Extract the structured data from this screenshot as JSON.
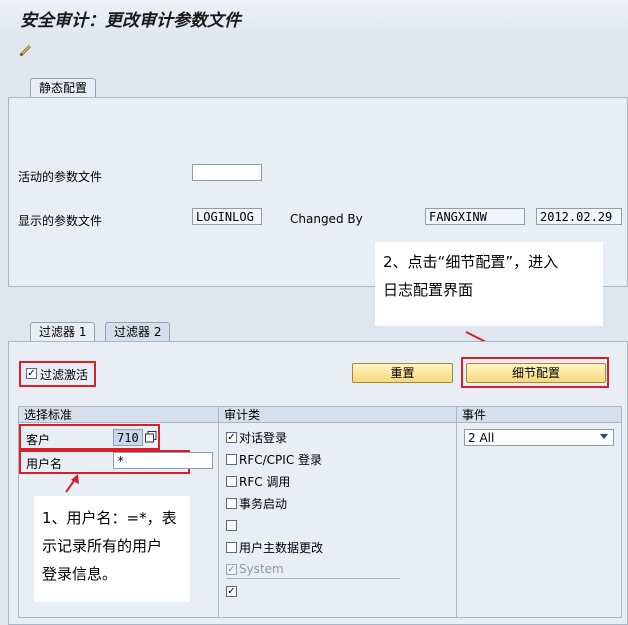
{
  "window": {
    "title": "安全审计：更改审计参数文件"
  },
  "toolbar": {
    "icon": "edit-pencil-icon"
  },
  "static_tab": {
    "label": "静态配置"
  },
  "fields": {
    "active_profile_label": "活动的参数文件",
    "active_profile_value": "",
    "shown_profile_label": "显示的参数文件",
    "shown_profile_value": "LOGINLOG",
    "changed_by_label": "Changed By",
    "changed_by_value": "FANGXINW",
    "changed_date_value": "2012.02.29"
  },
  "callout_top": {
    "line1": "2、点击“细节配置”，进入",
    "line2": "日志配置界面"
  },
  "filter_tabs": [
    "过滤器 1",
    "过滤器 2"
  ],
  "filter": {
    "active_label": "过滤激活",
    "active_checked": true,
    "reset_button": "重置",
    "detail_button": "细节配置"
  },
  "selection": {
    "header": "选择标准",
    "client_label": "客户",
    "client_value": "710",
    "user_label": "用户名",
    "user_value": "*"
  },
  "audit_classes": {
    "header": "审计类",
    "items": [
      {
        "label": "对话登录",
        "checked": true,
        "disabled": false
      },
      {
        "label": "RFC/CPIC 登录",
        "checked": false,
        "disabled": false
      },
      {
        "label": "RFC 调用",
        "checked": false,
        "disabled": false
      },
      {
        "label": "事务启动",
        "checked": false,
        "disabled": false
      },
      {
        "label": "",
        "checked": false,
        "disabled": false
      },
      {
        "label": "用户主数据更改",
        "checked": false,
        "disabled": false
      },
      {
        "label": "System",
        "checked": true,
        "disabled": true
      },
      {
        "label": "",
        "checked": true,
        "disabled": false
      }
    ]
  },
  "events": {
    "header": "事件",
    "selected": "2 All"
  },
  "callout_bottom": {
    "line1": "1、用户名：=*，表",
    "line2": "示记录所有的用户",
    "line3": "登录信息。"
  },
  "colors": {
    "annotation_red": "#d6202a",
    "button_yellow": "#f7d97a",
    "panel_bg": "#e9eef4"
  }
}
